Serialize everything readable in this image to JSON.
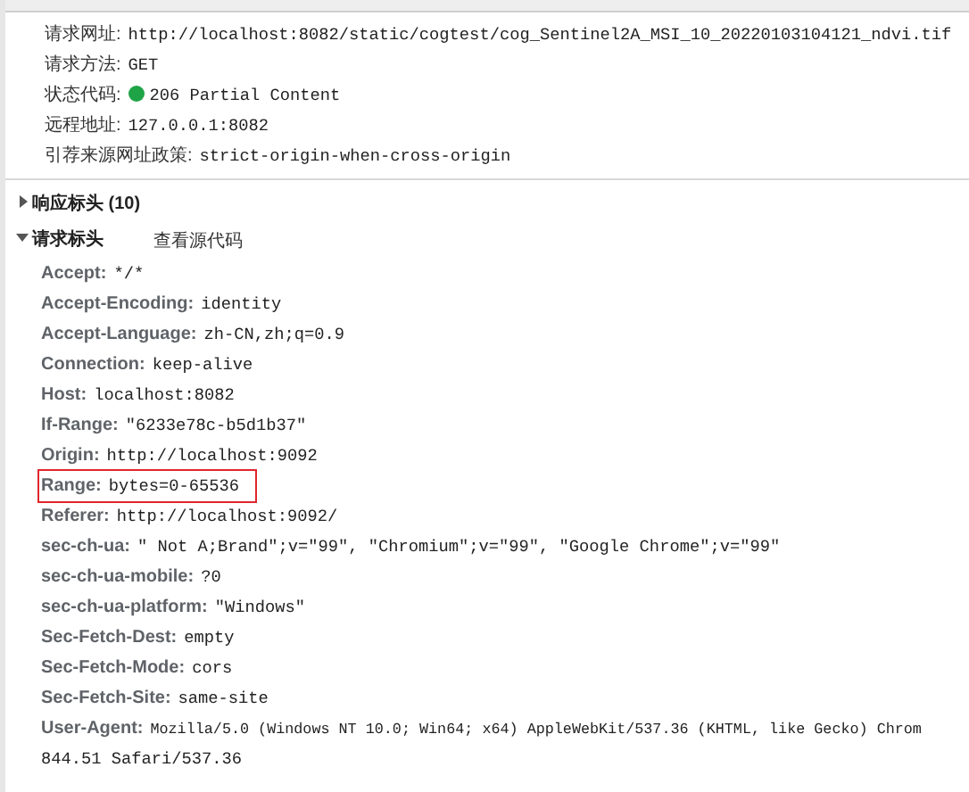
{
  "general": {
    "rows": [
      {
        "label": "请求网址:",
        "value": "http://localhost:8082/static/cogtest/cog_Sentinel2A_MSI_10_20220103104121_ndvi.tif"
      },
      {
        "label": "请求方法:",
        "value": "GET"
      },
      {
        "label": "状态代码:",
        "value": "206 Partial Content",
        "color": "#1ea446"
      },
      {
        "label": "远程地址:",
        "value": "127.0.0.1:8082"
      },
      {
        "label": "引荐来源网址政策:",
        "value": "strict-origin-when-cross-origin"
      }
    ]
  },
  "response_headers": {
    "title": "响应标头 (10)",
    "expanded": false
  },
  "request_headers": {
    "title": "请求标头",
    "expanded": true,
    "view_source": "查看源代码",
    "rows": [
      {
        "name": "Accept:",
        "value": "*/*",
        "highlighted": false
      },
      {
        "name": "Accept-Encoding:",
        "value": "identity",
        "highlighted": false
      },
      {
        "name": "Accept-Language:",
        "value": "zh-CN,zh;q=0.9",
        "highlighted": false
      },
      {
        "name": "Connection:",
        "value": "keep-alive",
        "highlighted": false
      },
      {
        "name": "Host:",
        "value": "localhost:8082",
        "highlighted": false
      },
      {
        "name": "If-Range:",
        "value": "\"6233e78c-b5d1b37\"",
        "highlighted": false
      },
      {
        "name": "Origin:",
        "value": "http://localhost:9092",
        "highlighted": false
      },
      {
        "name": "Range:",
        "value": "bytes=0-65536",
        "highlighted": true
      },
      {
        "name": "Referer:",
        "value": "http://localhost:9092/",
        "highlighted": false
      },
      {
        "name": "sec-ch-ua:",
        "value": "\" Not A;Brand\";v=\"99\", \"Chromium\";v=\"99\", \"Google Chrome\";v=\"99\"",
        "highlighted": false
      },
      {
        "name": "sec-ch-ua-mobile:",
        "value": "?0",
        "highlighted": false
      },
      {
        "name": "sec-ch-ua-platform:",
        "value": "\"Windows\"",
        "highlighted": false
      },
      {
        "name": "Sec-Fetch-Dest:",
        "value": "empty",
        "highlighted": false
      },
      {
        "name": "Sec-Fetch-Mode:",
        "value": "cors",
        "highlighted": false
      },
      {
        "name": "Sec-Fetch-Site:",
        "value": "same-site",
        "highlighted": false
      },
      {
        "name": "User-Agent:",
        "value": "Mozilla/5.0 (Windows NT 10.0; Win64; x64) AppleWebKit/537.36 (KHTML, like Gecko) Chrom",
        "highlighted": false,
        "continuation": "844.51 Safari/537.36"
      }
    ]
  }
}
